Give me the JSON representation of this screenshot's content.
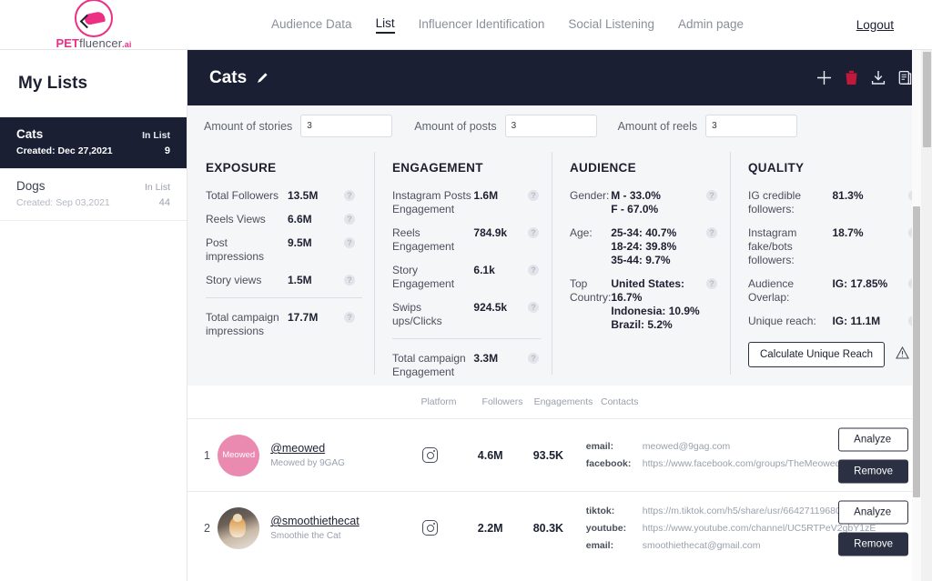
{
  "brand": {
    "part1": "PET",
    "part2": "fluencer",
    "part3": ".ai",
    "logo_icon": "pet-logo-icon"
  },
  "topnav": {
    "links": [
      {
        "label": "Audience Data",
        "active": false
      },
      {
        "label": "List",
        "active": true
      },
      {
        "label": "Influencer Identification",
        "active": false
      },
      {
        "label": "Social Listening",
        "active": false
      },
      {
        "label": "Admin page",
        "active": false
      }
    ],
    "logout": "Logout"
  },
  "sidebar": {
    "title": "My Lists",
    "items": [
      {
        "name": "Cats",
        "created": "Created: Dec 27,2021",
        "in_list_label": "In List",
        "count": "9",
        "selected": true
      },
      {
        "name": "Dogs",
        "created": "Created: Sep 03,2021",
        "in_list_label": "In List",
        "count": "44",
        "selected": false
      }
    ]
  },
  "panel": {
    "title": "Cats",
    "edit_icon": "pencil-icon",
    "actions": [
      {
        "icon": "plus-icon",
        "name": "add-influencer-button"
      },
      {
        "icon": "trash-icon",
        "name": "delete-list-button"
      },
      {
        "icon": "download-icon",
        "name": "export-list-button"
      },
      {
        "icon": "clipboard-icon",
        "name": "copy-list-button"
      }
    ]
  },
  "amounts": [
    {
      "label": "Amount of stories",
      "value": "3"
    },
    {
      "label": "Amount of posts",
      "value": "3"
    },
    {
      "label": "Amount of reels",
      "value": "3"
    }
  ],
  "stats": {
    "exposure": {
      "heading": "EXPOSURE",
      "rows": [
        {
          "label": "Total Followers",
          "value": "13.5M"
        },
        {
          "label": "Reels Views",
          "value": "6.6M"
        },
        {
          "label": "Post impressions",
          "value": "9.5M"
        },
        {
          "label": "Story views",
          "value": "1.5M"
        }
      ],
      "total": {
        "label": "Total campaign impressions",
        "value": "17.7M"
      }
    },
    "engagement": {
      "heading": "ENGAGEMENT",
      "rows": [
        {
          "label": "Instagram Posts Engagement",
          "value": "1.6M"
        },
        {
          "label": "Reels Engagement",
          "value": "784.9k"
        },
        {
          "label": "Story Engagement",
          "value": "6.1k"
        },
        {
          "label": "Swips ups/Clicks",
          "value": "924.5k"
        }
      ],
      "total": {
        "label": "Total campaign Engagement",
        "value": "3.3M"
      }
    },
    "audience": {
      "heading": "AUDIENCE",
      "gender": {
        "label": "Gender:",
        "line1": "M - 33.0%",
        "line2": "F - 67.0%"
      },
      "age": {
        "label": "Age:",
        "line1": "25-34: 40.7%",
        "line2": "18-24: 39.8%",
        "line3": "35-44: 9.7%"
      },
      "country": {
        "label": "Top Country:",
        "line1": "United States: 16.7%",
        "line2": "Indonesia: 10.9%",
        "line3": "Brazil: 5.2%"
      }
    },
    "quality": {
      "heading": "QUALITY",
      "rows": [
        {
          "label": "IG credible followers:",
          "value": "81.3%"
        },
        {
          "label": "Instagram fake/bots followers:",
          "value": "18.7%"
        },
        {
          "label": "Audience Overlap:",
          "value": "IG: 17.85%"
        },
        {
          "label": "Unique reach:",
          "value": "IG: 11.1M"
        }
      ],
      "button": "Calculate Unique Reach",
      "warn_icon": "warning-triangle-icon"
    }
  },
  "table": {
    "columns": [
      "Platform",
      "Followers",
      "Engagements",
      "Contacts"
    ],
    "rows": [
      {
        "index": "1",
        "avatar_type": "initials",
        "avatar_text": "Meowed",
        "handle": "@meowed",
        "subtitle": "Meowed by 9GAG",
        "platform_icon": "instagram-icon",
        "followers": "4.6M",
        "engagements": "93.5K",
        "contacts": [
          {
            "key": "email:",
            "value": "meowed@9gag.com"
          },
          {
            "key": "facebook:",
            "value": "https://www.facebook.com/groups/TheMeowedClub"
          }
        ],
        "analyze": "Analyze",
        "remove": "Remove"
      },
      {
        "index": "2",
        "avatar_type": "photo",
        "avatar_text": "",
        "handle": "@smoothiethecat",
        "subtitle": "Smoothie the Cat",
        "platform_icon": "instagram-icon",
        "followers": "2.2M",
        "engagements": "80.3K",
        "contacts": [
          {
            "key": "tiktok:",
            "value": "https://m.tiktok.com/h5/share/usr/6642711968095420"
          },
          {
            "key": "youtube:",
            "value": "https://www.youtube.com/channel/UC5RTPeV2gbY1zE"
          },
          {
            "key": "email:",
            "value": "smoothiethecat@gmail.com"
          }
        ],
        "analyze": "Analyze",
        "remove": "Remove"
      }
    ]
  },
  "colors": {
    "accent": "#ec2f84",
    "dark": "#1b1f33",
    "panel_bg": "#f5f6f8",
    "danger": "#c2183c"
  }
}
